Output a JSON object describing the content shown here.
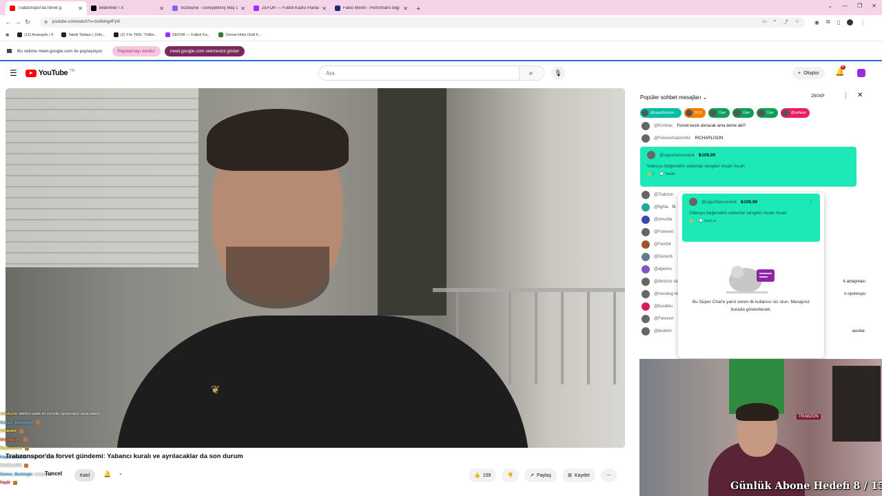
{
  "browser": {
    "tabs": [
      {
        "label": "Trabzonspor'da forvet g",
        "color": "#ff0000",
        "active": true
      },
      {
        "label": "Bildirimler / X",
        "color": "#000000",
        "active": false
      },
      {
        "label": "Sözleşme - Genişletilmiş Maç Ö",
        "color": "#7b68ee",
        "active": false
      },
      {
        "label": "ZEFOR — Futbol Kadro Planları",
        "color": "#9b30ff",
        "active": false
      },
      {
        "label": "Fabio Miretti - Performans bilgi",
        "color": "#1e2a78",
        "active": false
      }
    ],
    "new_tab": "+",
    "url": "youtube.com/watch?v=3uWdng4FyI0",
    "bookmarks": [
      "(12) Anasayfa / X",
      "Taktik Tahtası | Zefo...",
      "(2) X'te TMS: \"Gitfor...",
      "ZEFOR — Futbol Ka...",
      "Chrest Holis Outil F..."
    ],
    "share_bar": {
      "text": "Bu sekme meet.google.com ile paylaşılıyor",
      "stop_label": "Paylaşmayı durdur",
      "show_label": "meet.google.com sekmesini göster"
    }
  },
  "youtube": {
    "logo_text": "YouTube",
    "country": "TR",
    "search_placeholder": "Ara",
    "create_label": "Oluştur",
    "notif_count": "6"
  },
  "video": {
    "title": "Trabzonspor'da forvet gündemi: Yabancı kuralı ve ayrılacaklar da son durum",
    "channel": "Tuncel",
    "join_label": "Katıl",
    "likes": "159",
    "share_label": "Paylaş",
    "save_label": "Kaydet"
  },
  "chat_overlay": [
    {
      "name": "vututuzia",
      "text": ": atletico salak mı zorunlu opsiyonsuz sana satsın",
      "color": "#ffd54f"
    },
    {
      "name": "Somuz_Baslangic",
      "text": ":",
      "color": "#4fc3f7"
    },
    {
      "name": "Orhankrt",
      "text": ":",
      "color": "#ffeb3b"
    },
    {
      "name": "Mrbshacim",
      "text": ":",
      "color": "#ff7043"
    },
    {
      "name": "BayDemir61",
      "text": ":",
      "color": "#ffeb3b"
    },
    {
      "name": "Kaplanadam61",
      "text": ": tamam zorunlu 15",
      "color": "#4fc3f7"
    },
    {
      "name": "Rookies193",
      "text": ":",
      "color": "#ffffff"
    },
    {
      "name": "Somuz_Baslangic",
      "text": ": tuzlayarak",
      "color": "#4fc3f7"
    },
    {
      "name": "Faş3r",
      "text": ":",
      "color": "#ff5252"
    }
  ],
  "chat_panel": {
    "title": "Popüler sohbet mesajları",
    "xp": "250XP",
    "tickers": [
      {
        "label": "@oguzhancor...",
        "color": "#00bfa5"
      },
      {
        "label": "10  5",
        "color": "#f57c00"
      },
      {
        "label": "Üye",
        "color": "#0f9d58"
      },
      {
        "label": "Üye",
        "color": "#0f9d58"
      },
      {
        "label": "Üye",
        "color": "#0f9d58"
      },
      {
        "label": "@safasa",
        "color": "#e91e63"
      }
    ],
    "messages_top": [
      {
        "name": "@61mirac",
        "text": "Forvet kesin alınacak ama deme abi?"
      },
      {
        "name": "@Forevertrabzon61",
        "text": "RICHARLISON"
      }
    ],
    "superchat": {
      "name": "@oguzhancorduk",
      "amount": "₺109,99",
      "text": "Videoyu beğenelim selamlar sevgiler muah muah",
      "likes": "1",
      "reply": "Yanıtla"
    },
    "messages_bottom": [
      {
        "name": "@Trabzon",
        "text": ""
      },
      {
        "name": "@fighta",
        "text": "N"
      },
      {
        "name": "@omurba",
        "text": ""
      },
      {
        "name": "@Forevert",
        "text": ""
      },
      {
        "name": "@Ferit34",
        "text": ""
      },
      {
        "name": "@Gezen6",
        "text": ""
      },
      {
        "name": "@alpemu",
        "text": ""
      },
      {
        "name": "@denizoz olacmi",
        "text": "k anlaşması"
      },
      {
        "name": "@muratog kiralama y",
        "text": "n oyuncuyu"
      },
      {
        "name": "@burakku",
        "text": ""
      },
      {
        "name": "@Forevert",
        "text": ""
      },
      {
        "name": "@ibrahim",
        "text": "asınlar."
      }
    ],
    "popup": {
      "name": "@oguzhancorduk",
      "amount": "₺109,99",
      "text": "Videoyu beğenelim selamlar sevgiler muah muah",
      "reply": "Satın al",
      "message": "Bu Süper Chat'e yanıt veren ilk kullanıcı siz olun. Mesajınız burada gösterilecek."
    }
  },
  "webcam": {
    "overlay_text": "Günlük Abone Hedefi 8 / 15",
    "sign": "TRABZON"
  }
}
